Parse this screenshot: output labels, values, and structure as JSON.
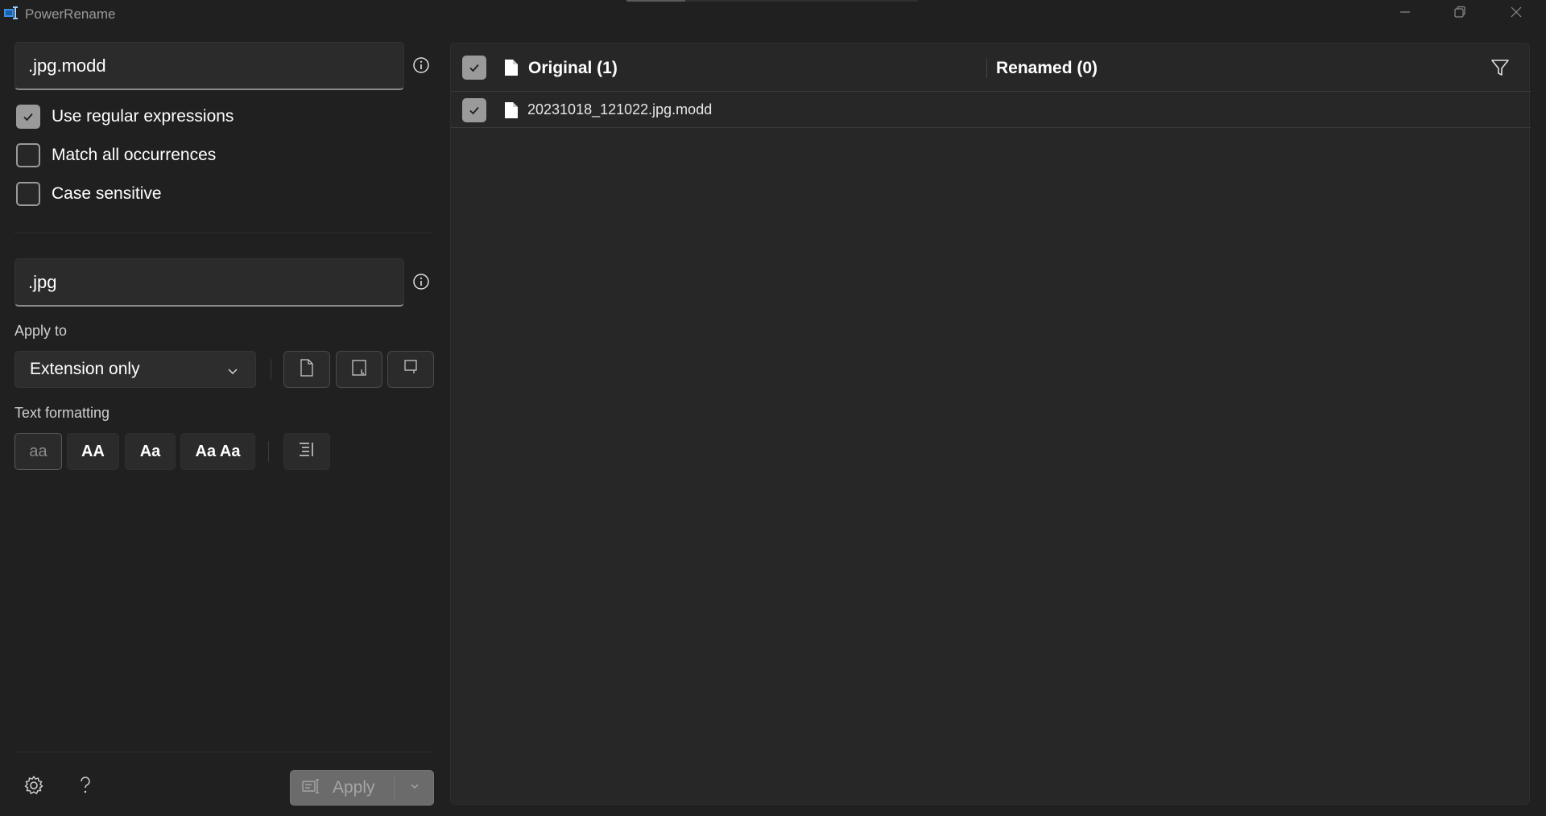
{
  "window": {
    "title": "PowerRename",
    "icon": "powerrename-app-icon",
    "controls": [
      "minimize-icon",
      "restore-icon",
      "close-icon"
    ]
  },
  "search": {
    "value": ".jpg.modd",
    "info_icon": "info-icon"
  },
  "options": [
    {
      "label": "Use regular expressions",
      "checked": true
    },
    {
      "label": "Match all occurrences",
      "checked": false
    },
    {
      "label": "Case sensitive",
      "checked": false
    }
  ],
  "replace": {
    "value": ".jpg",
    "info_icon": "info-icon"
  },
  "apply_to": {
    "label": "Apply to",
    "selected": "Extension only",
    "toggle_icons": [
      "include-files-icon",
      "include-folders-icon",
      "include-subfolders-icon"
    ]
  },
  "text_formatting": {
    "label": "Text formatting",
    "buttons": [
      {
        "label": "aa",
        "selected": true
      },
      {
        "label": "AA",
        "selected": false
      },
      {
        "label": "Aa",
        "selected": false
      },
      {
        "label": "Aa Aa",
        "selected": false
      }
    ],
    "enumerate_icon": "enumerate-items-icon"
  },
  "footer": {
    "settings_icon": "gear-icon",
    "help_icon": "help-icon",
    "apply_label": "Apply",
    "apply_enabled": false
  },
  "list": {
    "header_original": "Original (1)",
    "header_renamed": "Renamed (0)",
    "filter_icon": "filter-icon",
    "rows": [
      {
        "original": "20231018_121022.jpg.modd",
        "renamed": "",
        "checked": true
      }
    ]
  },
  "colors": {
    "background": "#202020",
    "pane": "#272727",
    "checkbox_checked": "#9a9a9a",
    "accent_blue": "#3a8ee6"
  }
}
